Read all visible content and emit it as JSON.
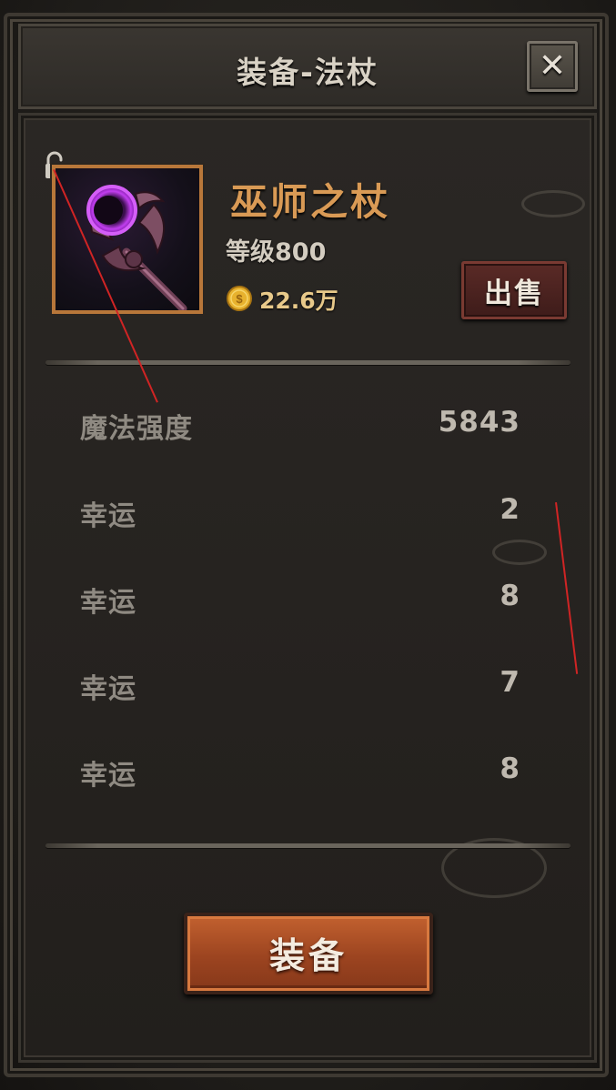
{
  "window": {
    "title": "装备-法杖",
    "close_icon": "✕"
  },
  "item": {
    "name": "巫师之杖",
    "level_text": "等级800",
    "price": "22.6万",
    "lock_icon": "unlocked-padlock-icon",
    "coin_icon": "gold-coin-icon",
    "image": "purple-wizard-staff",
    "name_color": "#d99a55"
  },
  "sell_button": {
    "label": "出售"
  },
  "stats": [
    {
      "name": "魔法强度",
      "value": "5843"
    },
    {
      "name": "幸运",
      "value": "2"
    },
    {
      "name": "幸运",
      "value": "8"
    },
    {
      "name": "幸运",
      "value": "7"
    },
    {
      "name": "幸运",
      "value": "8"
    }
  ],
  "equip_button": {
    "label": "装备"
  }
}
